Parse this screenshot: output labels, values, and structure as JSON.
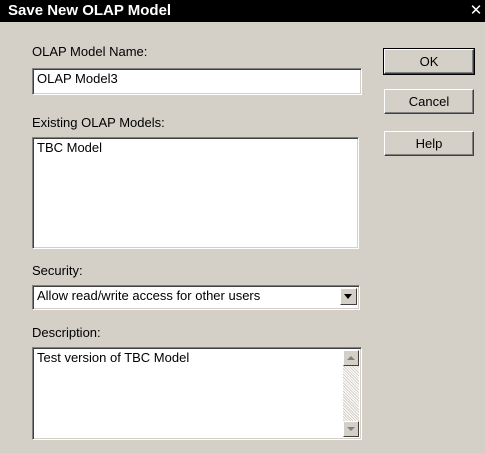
{
  "window": {
    "title": "Save New OLAP Model",
    "close_glyph": "✕"
  },
  "model_name": {
    "label": "OLAP Model Name:",
    "value": "OLAP Model3"
  },
  "existing_models": {
    "label": "Existing OLAP Models:",
    "items": [
      "TBC Model"
    ]
  },
  "security": {
    "label": "Security:",
    "selected": "Allow read/write access for other users"
  },
  "description": {
    "label": "Description:",
    "value": "Test version of TBC Model"
  },
  "buttons": {
    "ok": "OK",
    "cancel": "Cancel",
    "help": "Help"
  },
  "icons": {
    "dropdown": "chevron-down-icon",
    "scroll_up": "scroll-up-arrow-icon",
    "scroll_down": "scroll-down-arrow-icon"
  },
  "colors": {
    "dialog_bg": "#d4d0c8",
    "titlebar_bg": "#000000",
    "titlebar_text": "#ffffff"
  }
}
